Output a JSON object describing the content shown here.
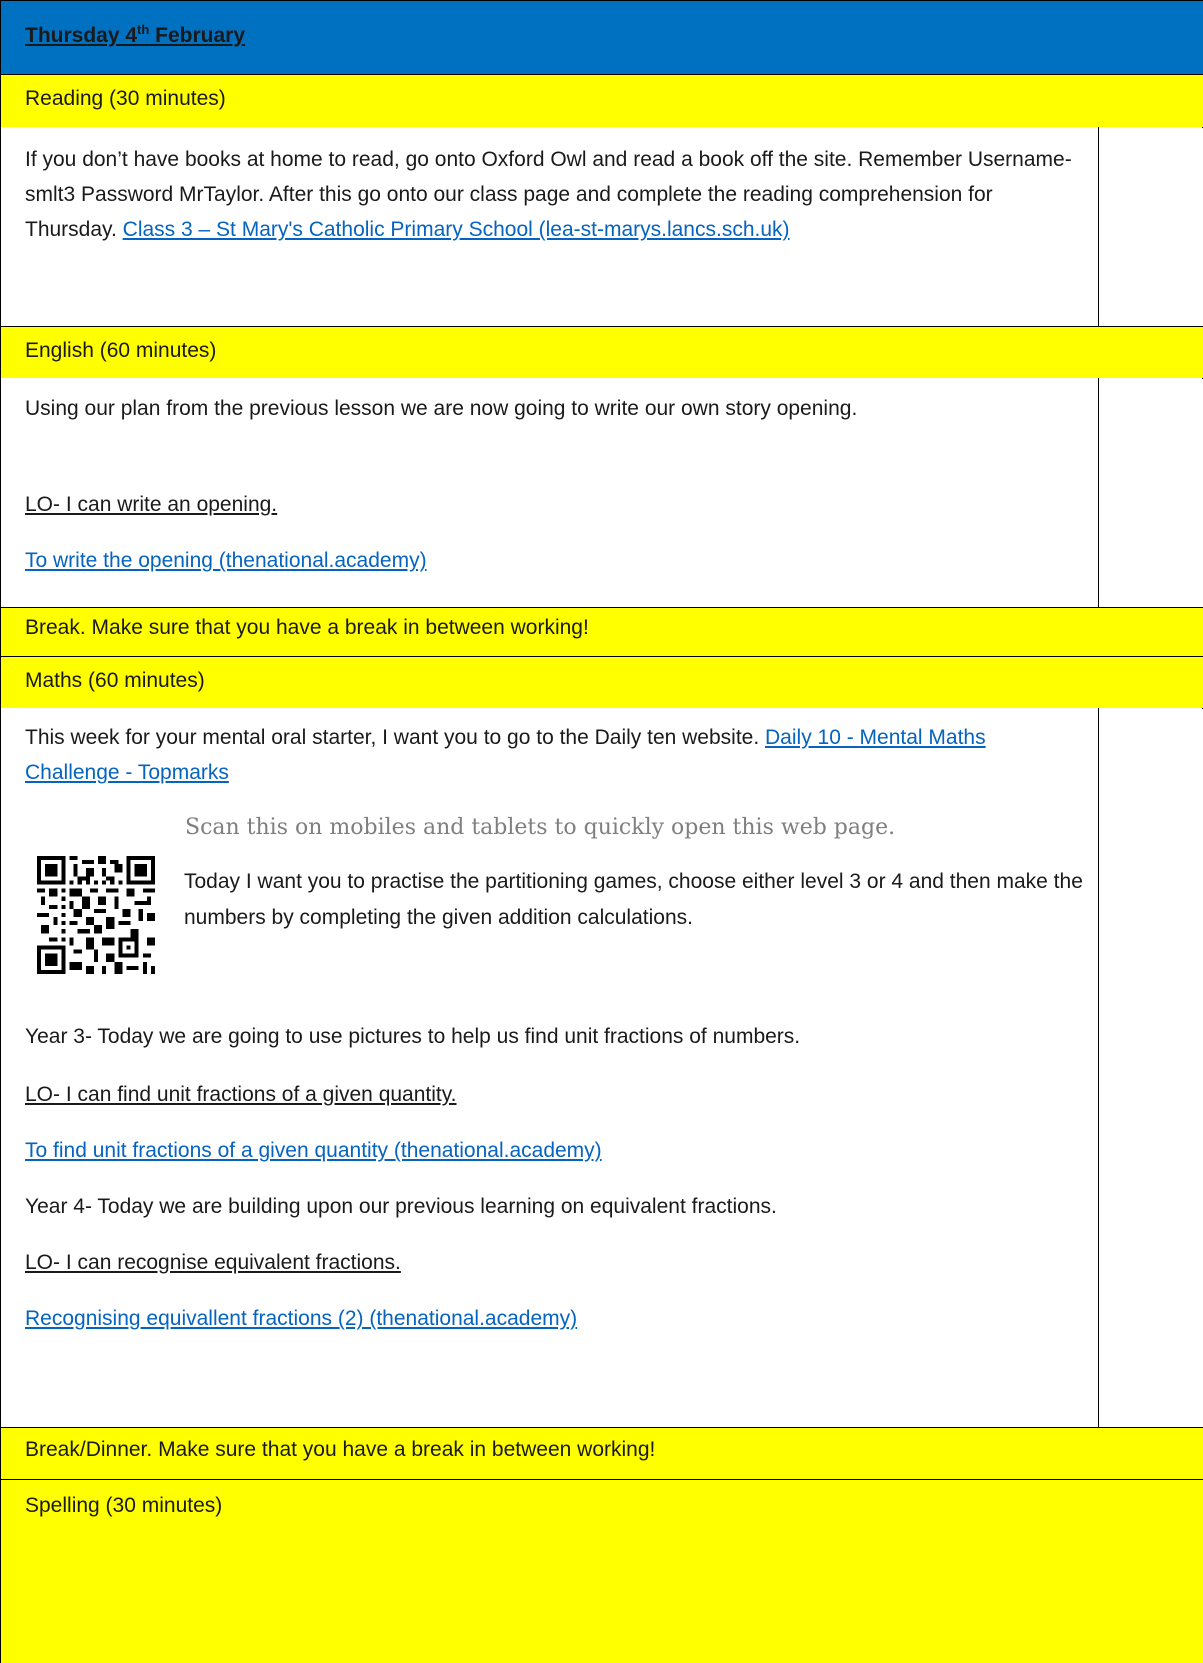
{
  "header": {
    "title_main": "Thursday 4",
    "title_sup": "th",
    "title_end": " February"
  },
  "reading": {
    "heading": "Reading (30 minutes)",
    "body": "If you don’t have books at home to read, go onto Oxford Owl and read a book off the site. Remember Username- smlt3 Password MrTaylor. After this go onto our class page and complete the reading comprehension for Thursday. ",
    "link": "Class 3 – St Mary's Catholic Primary School (lea-st-marys.lancs.sch.uk)"
  },
  "english": {
    "heading": "English (60 minutes)",
    "body": "Using our plan from the previous lesson we are now going to write our own story opening.",
    "lo": "LO- I can write an opening.",
    "link": "To write the opening (thenational.academy)"
  },
  "break1": {
    "text": "Break. Make sure that you have a break in between working!"
  },
  "maths": {
    "heading": "Maths (60 minutes)",
    "intro": "This week for your mental oral starter, I want you to go to the Daily ten website. ",
    "intro_link": "Daily 10 - Mental Maths Challenge - Topmarks",
    "scan": "Scan this on mobiles and tablets to quickly open this web page.",
    "practise": " Today I want you to practise the partitioning games, choose either level 3 or 4 and then make the numbers by completing the given addition calculations.",
    "y3": "Year 3- Today we are going to use pictures to help us find unit fractions of numbers.",
    "y3_lo": "LO- I can find unit fractions of a given quantity.",
    "y3_link": "To find unit fractions of a given quantity (thenational.academy)",
    "y4": "Year 4- Today we are building upon our previous learning on equivalent fractions.",
    "y4_lo": "LO- I can recognise equivalent fractions.",
    "y4_link": "Recognising equivallent fractions (2) (thenational.academy)"
  },
  "break2": {
    "text": "Break/Dinner. Make sure that you have a break in between working!"
  },
  "spelling": {
    "heading": "Spelling (30 minutes)"
  }
}
